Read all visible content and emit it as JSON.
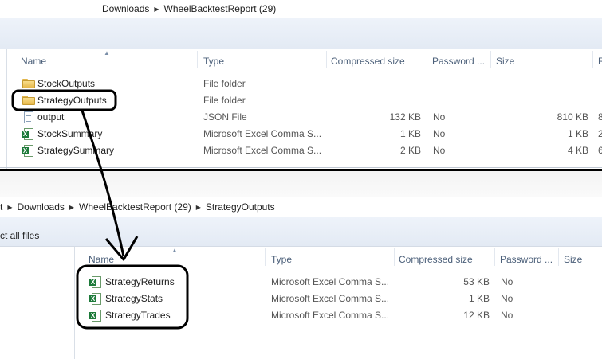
{
  "top": {
    "breadcrumb": [
      "Downloads",
      "WheelBacktestReport (29)"
    ],
    "columns": {
      "name": "Name",
      "type": "Type",
      "compressed": "Compressed size",
      "password": "Password ...",
      "size": "Size",
      "ratio": "R"
    },
    "files": [
      {
        "name": "StockOutputs",
        "icon": "folder-icon",
        "type": "File folder",
        "compressed": "",
        "password": "",
        "size": "",
        "ratio": ""
      },
      {
        "name": "StrategyOutputs",
        "icon": "folder-icon",
        "type": "File folder",
        "compressed": "",
        "password": "",
        "size": "",
        "ratio": ""
      },
      {
        "name": "output",
        "icon": "json-file-icon",
        "type": "JSON File",
        "compressed": "132 KB",
        "password": "No",
        "size": "810 KB",
        "ratio": "8"
      },
      {
        "name": "StockSummary",
        "icon": "excel-csv-icon",
        "type": "Microsoft Excel Comma S...",
        "compressed": "1 KB",
        "password": "No",
        "size": "1 KB",
        "ratio": "2"
      },
      {
        "name": "StrategySummary",
        "icon": "excel-csv-icon",
        "type": "Microsoft Excel Comma S...",
        "compressed": "2 KB",
        "password": "No",
        "size": "4 KB",
        "ratio": "6"
      }
    ]
  },
  "bottom": {
    "breadcrumb": [
      "t",
      "Downloads",
      "WheelBacktestReport (29)",
      "StrategyOutputs"
    ],
    "toolbar_label": "ct all files",
    "columns": {
      "name": "Name",
      "type": "Type",
      "compressed": "Compressed size",
      "password": "Password ...",
      "size": "Size"
    },
    "files": [
      {
        "name": "StrategyReturns",
        "icon": "excel-csv-icon",
        "type": "Microsoft Excel Comma S...",
        "compressed": "53 KB",
        "password": "No"
      },
      {
        "name": "StrategyStats",
        "icon": "excel-csv-icon",
        "type": "Microsoft Excel Comma S...",
        "compressed": "1 KB",
        "password": "No"
      },
      {
        "name": "StrategyTrades",
        "icon": "excel-csv-icon",
        "type": "Microsoft Excel Comma S...",
        "compressed": "12 KB",
        "password": "No"
      }
    ]
  },
  "colors": {
    "annotation": "#000000",
    "header_text": "#4c607a",
    "excel_green": "#1d7a3a"
  }
}
